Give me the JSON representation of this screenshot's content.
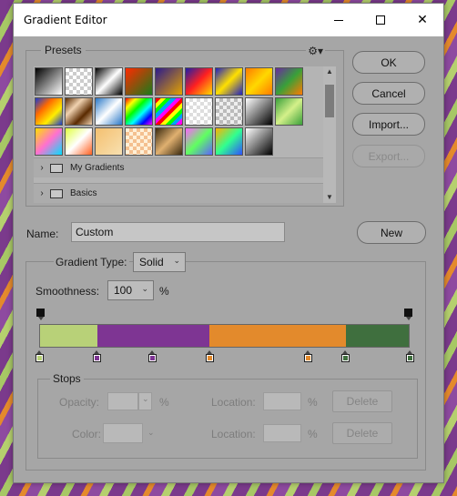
{
  "window": {
    "title": "Gradient Editor"
  },
  "presets": {
    "label": "Presets",
    "gear_icon": "gear-icon",
    "swatches": [
      "linear-gradient(135deg,#000,#fff)",
      "repeating-conic-gradient(#ccc 0 25%,#fff 0 50%) 0 0/8px 8px",
      "linear-gradient(135deg,#000,#fff,#000)",
      "linear-gradient(135deg,#ff2a00,#1a7a1a)",
      "linear-gradient(135deg,#2b1a8c,#e3a200)",
      "linear-gradient(135deg,#1e1ea8,#ff2020,#ffdd00)",
      "linear-gradient(135deg,#2020c0,#ffe000,#2020c0)",
      "linear-gradient(135deg,#ff7a00,#ffd800,#ff7a00)",
      "linear-gradient(135deg,#6a2aa0,#39a039,#ff7a00)",
      "linear-gradient(135deg,#1a3ad0,#ff6a00,#ffee00,#1a3ad0)",
      "linear-gradient(135deg,#5a2a00,#f0d2b0,#5a2a00,#f0d2b0)",
      "linear-gradient(135deg,#2a78c8,#fff,#2a78c8)",
      "linear-gradient(135deg,#ff0000,#ffff00,#00ff00,#00ffff,#0000ff,#ff00ff)",
      "repeating-linear-gradient(135deg,#ff0000 0 4px,#ffff00 4px 8px,#00ff00 8px 12px,#00a0ff 12px 16px,#ff00ff 16px 20px)",
      "repeating-conic-gradient(#ddd 0 25%,#fff 0 50%) 0 0/8px 8px",
      "repeating-conic-gradient(#bbb 0 25%,#eee 0 50%) 0 0/8px 8px",
      "linear-gradient(135deg,#fff,#000)",
      "linear-gradient(135deg,#3aa03a,#d4f08a,#3aa03a)",
      "linear-gradient(135deg,#ffe000,#ff70d0,#00e0ff)",
      "linear-gradient(135deg,#e0ff40,#fff,#ff6020)",
      "linear-gradient(135deg,#f4c070,#f8e0b0)",
      "repeating-conic-gradient(#f4c090 0 25%,#fff0d8 0 50%) 0 0/8px 8px",
      "linear-gradient(135deg,#3a2a10,#e0b070,#3a2a10)",
      "linear-gradient(135deg,#ff60ff,#60ff60,#6060ff)",
      "linear-gradient(135deg,#ffb000,#30ff90,#3050ff)",
      "linear-gradient(135deg,#fff,#000)"
    ],
    "folders": [
      {
        "label": "My Gradients"
      },
      {
        "label": "Basics"
      }
    ]
  },
  "buttons": {
    "ok": "OK",
    "cancel": "Cancel",
    "import": "Import...",
    "export": "Export...",
    "new": "New"
  },
  "name": {
    "label": "Name:",
    "value": "Custom"
  },
  "gradient_type": {
    "label": "Gradient Type:",
    "value": "Solid",
    "smoothness_label": "Smoothness:",
    "smoothness_value": "100",
    "smoothness_unit": "%"
  },
  "gradient": {
    "colors": {
      "green_light": "#b8d178",
      "purple": "#7e3593",
      "orange": "#e38a2c",
      "green_dark": "#3f6f3e"
    },
    "segments": [
      {
        "color": "#b8d178",
        "fraction": 0.155
      },
      {
        "color": "#7e3593",
        "fraction": 0.305
      },
      {
        "color": "#e38a2c",
        "fraction": 0.37
      },
      {
        "color": "#3f6f3e",
        "fraction": 0.17
      }
    ],
    "opacity_stops": [
      0,
      1
    ],
    "color_stops": [
      {
        "pos": 0.0,
        "color": "#b8d178"
      },
      {
        "pos": 0.155,
        "color": "#7e3593"
      },
      {
        "pos": 0.305,
        "color": "#7e3593"
      },
      {
        "pos": 0.46,
        "color": "#e38a2c"
      },
      {
        "pos": 0.725,
        "color": "#e38a2c"
      },
      {
        "pos": 0.825,
        "color": "#3f6f3e"
      },
      {
        "pos": 1.0,
        "color": "#3f6f3e"
      }
    ]
  },
  "stops": {
    "label": "Stops",
    "opacity_label": "Opacity:",
    "location_label": "Location:",
    "color_label": "Color:",
    "pct": "%",
    "delete_label": "Delete"
  }
}
